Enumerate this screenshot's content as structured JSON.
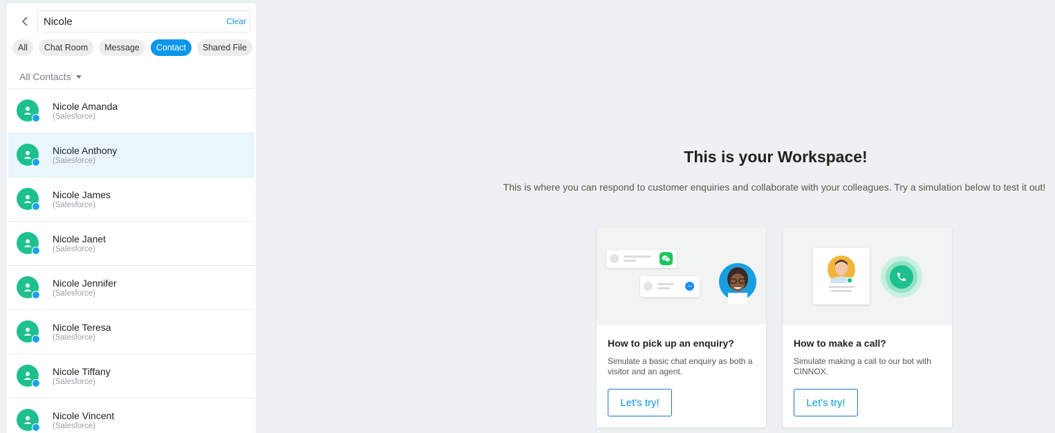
{
  "search": {
    "value": "Nicole",
    "clear_label": "Clear"
  },
  "filters": [
    {
      "label": "All",
      "active": false
    },
    {
      "label": "Chat Room",
      "active": false
    },
    {
      "label": "Message",
      "active": false
    },
    {
      "label": "Contact",
      "active": true
    },
    {
      "label": "Shared File",
      "active": false
    }
  ],
  "contact_filter": "All Contacts",
  "contacts": [
    {
      "name": "Nicole Amanda",
      "source": "(Salesforce)"
    },
    {
      "name": "Nicole Anthony",
      "source": "(Salesforce)"
    },
    {
      "name": "Nicole James",
      "source": "(Salesforce)"
    },
    {
      "name": "Nicole Janet",
      "source": "(Salesforce)"
    },
    {
      "name": "Nicole Jennifer",
      "source": "(Salesforce)"
    },
    {
      "name": "Nicole Teresa",
      "source": "(Salesforce)"
    },
    {
      "name": "Nicole Tiffany",
      "source": "(Salesforce)"
    },
    {
      "name": "Nicole Vincent",
      "source": "(Salesforce)"
    }
  ],
  "selected_contact": "Nicole Anthony",
  "workspace": {
    "title": "This is your Workspace!",
    "subtitle": "This is where you can respond to customer enquiries and collaborate with your colleagues. Try a simulation below to test it out!"
  },
  "cards": [
    {
      "title": "How to pick up an enquiry?",
      "description": "Simulate a basic chat enquiry as both a visitor and an agent.",
      "button": "Let's try!"
    },
    {
      "title": "How to make a call?",
      "description": "Simulate making a call to our bot with CINNOX.",
      "button": "Let's try!"
    }
  ],
  "colors": {
    "accent": "#0a96ea",
    "avatar": "#1ec08e",
    "selected_row": "#e9f6fc",
    "background": "#edf1f1"
  },
  "icons": [
    "back-arrow-icon",
    "person-icon",
    "chat-badge-icon",
    "wechat-icon",
    "messenger-icon",
    "phone-icon"
  ]
}
